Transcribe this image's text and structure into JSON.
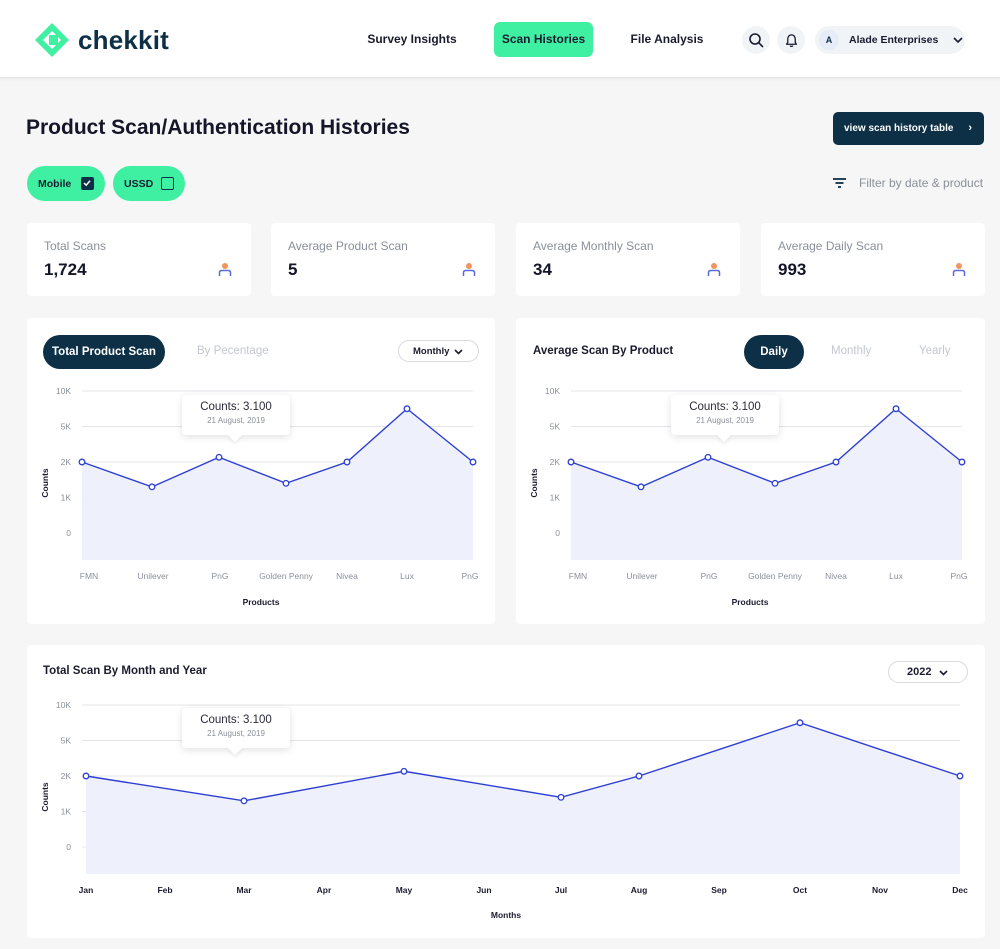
{
  "header": {
    "logo_text": "chekkit",
    "nav": [
      "Survey Insights",
      "Scan Histories",
      "File Analysis"
    ],
    "active_nav": "Scan Histories",
    "account_initial": "A",
    "account_name": "Alade Enterprises"
  },
  "page": {
    "title": "Product Scan/Authentication Histories",
    "view_button": "view scan history table",
    "channels": [
      {
        "label": "Mobile",
        "checked": true
      },
      {
        "label": "USSD",
        "checked": false
      }
    ],
    "filter_label": "Filter by date & product"
  },
  "stats": [
    {
      "label": "Total Scans",
      "value": "1,724"
    },
    {
      "label": "Average Product Scan",
      "value": "5"
    },
    {
      "label": "Average Monthly Scan",
      "value": "34"
    },
    {
      "label": "Average Daily Scan",
      "value": "993"
    }
  ],
  "panel1": {
    "tab_active": "Total Product Scan",
    "tab_inactive": "By Pecentage",
    "dropdown": "Monthly"
  },
  "panel2": {
    "title": "Average  Scan By Product",
    "tabs": [
      "Daily",
      "Monthly",
      "Yearly"
    ],
    "active_tab": "Daily"
  },
  "panel3": {
    "title": "Total  Scan By Month and Year",
    "dropdown": "2022"
  },
  "tooltip": {
    "title": "Counts: 3.100",
    "date": "21 August, 2019"
  },
  "colors": {
    "brand_green": "#3ff0a2",
    "navy": "#0d3046",
    "line": "#2d3fd3",
    "area": "#eef0fc",
    "stat_icon": "#f0955e"
  },
  "chart_data": [
    {
      "type": "area",
      "title": "",
      "xlabel": "Products",
      "ylabel": "Counts",
      "categories": [
        "FMN",
        "Unilever",
        "PnG",
        "Golden Penny",
        "Nivea",
        "Lux",
        "PnG"
      ],
      "y_ticks": [
        "10K",
        "5K",
        "2K",
        "1K",
        "0"
      ],
      "series": [
        {
          "values": [
            2000,
            1300,
            2400,
            1400,
            2000,
            7500,
            2000
          ]
        }
      ]
    },
    {
      "type": "area",
      "title": "Average  Scan By Product",
      "xlabel": "Products",
      "ylabel": "Counts",
      "categories": [
        "FMN",
        "Unilever",
        "PnG",
        "Golden Penny",
        "Nivea",
        "Lux",
        "PnG"
      ],
      "y_ticks": [
        "10K",
        "5K",
        "2K",
        "1K",
        "0"
      ],
      "series": [
        {
          "values": [
            2000,
            1300,
            2400,
            1400,
            2000,
            7500,
            2000
          ]
        }
      ]
    },
    {
      "type": "area",
      "title": "Total  Scan By Month and Year",
      "xlabel": "Months",
      "ylabel": "Counts",
      "categories": [
        "Jan",
        "Feb",
        "Mar",
        "Apr",
        "May",
        "Jun",
        "Jul",
        "Aug",
        "Sep",
        "Oct",
        "Nov",
        "Dec"
      ],
      "y_ticks": [
        "10K",
        "5K",
        "2K",
        "1K",
        "0"
      ],
      "series": [
        {
          "points": [
            [
              "Jan",
              2000
            ],
            [
              "Mar",
              1300
            ],
            [
              "May",
              2400
            ],
            [
              "Jul",
              1400
            ],
            [
              "Aug",
              2000
            ],
            [
              "Oct",
              7500
            ],
            [
              "Dec",
              2000
            ]
          ]
        }
      ]
    }
  ]
}
